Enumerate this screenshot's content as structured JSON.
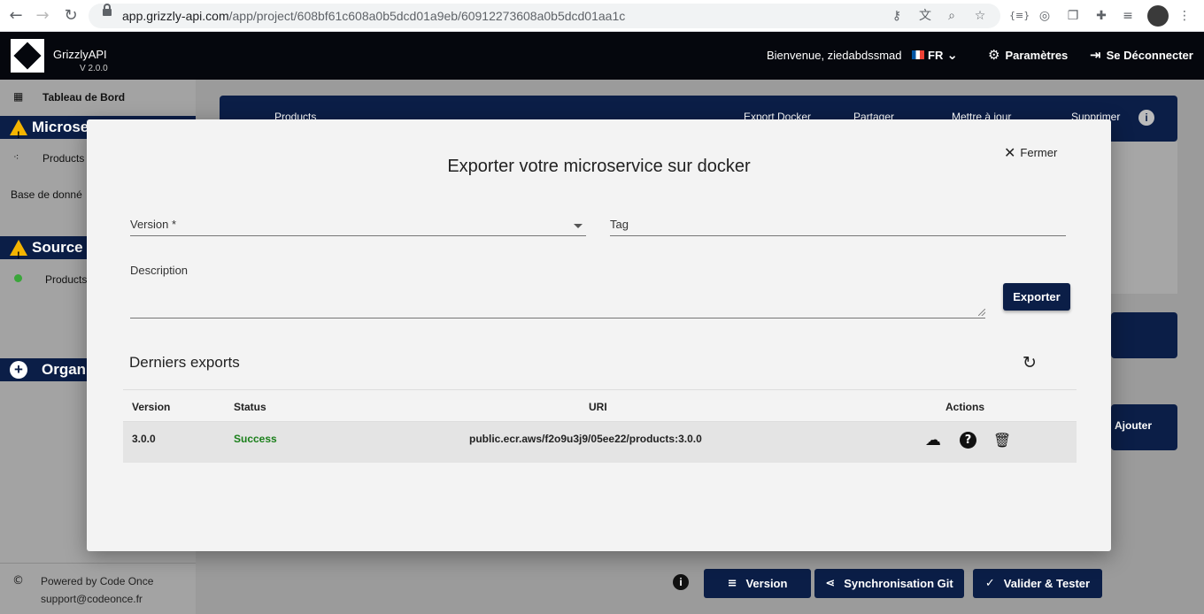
{
  "browser": {
    "url_host": "app.grizzly-api.com",
    "url_path": "/app/project/608bf61c608a0b5dcd01a9eb/60912273608a0b5dcd01aa1c"
  },
  "header": {
    "app_name": "GrizzlyAPI",
    "version": "V 2.0.0",
    "welcome": "Bienvenue,  ziedabdssmad",
    "lang": "FR",
    "settings": "Paramètres",
    "logout": "Se Déconnecter"
  },
  "sidebar": {
    "dashboard": "Tableau de Bord",
    "microservices": "Microse",
    "products_item": "Products",
    "database": "Base de donné",
    "source": "Source",
    "source_item": "Products",
    "organisation": "Organi",
    "powered": "Powered by Code Once",
    "support": "support@codeonce.fr"
  },
  "background": {
    "banner_title": "Products",
    "export_docker": "Export Docker",
    "share": "Partager",
    "update": "Mettre à jour",
    "delete": "Supprimer",
    "add": "Ajouter",
    "version_btn": "Version",
    "git_btn": "Synchronisation Git",
    "validate_btn": "Valider & Tester"
  },
  "modal": {
    "title": "Exporter votre microservice sur docker",
    "close": "Fermer",
    "version_label": "Version *",
    "tag_label": "Tag",
    "description_label": "Description",
    "export_button": "Exporter",
    "section_title": "Derniers exports",
    "table": {
      "headers": [
        "Version",
        "Status",
        "URI",
        "Actions"
      ],
      "rows": [
        {
          "version": "3.0.0",
          "status": "Success",
          "uri": "public.ecr.aws/f2o9u3j9/05ee22/products:3.0.0"
        }
      ]
    }
  },
  "colors": {
    "navy": "#0b1e47",
    "success": "#1a7f1a",
    "header_bg": "#05070d"
  }
}
